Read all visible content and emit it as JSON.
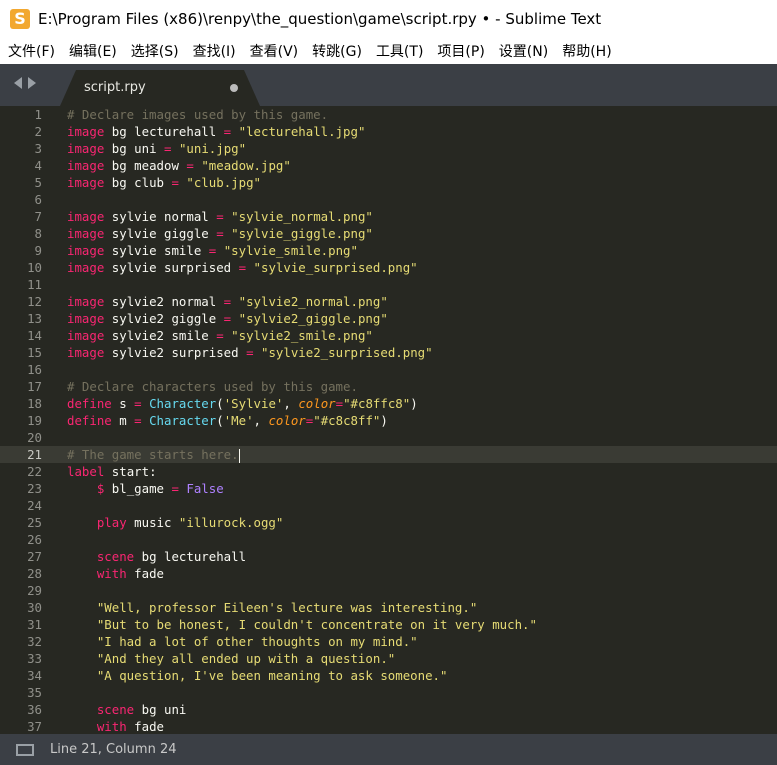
{
  "window": {
    "title": "E:\\Program Files (x86)\\renpy\\the_question\\game\\script.rpy • - Sublime Text",
    "icon": "sublime-text-icon",
    "accent": "#f2a830"
  },
  "menu": [
    {
      "label": "文件(F)"
    },
    {
      "label": "编辑(E)"
    },
    {
      "label": "选择(S)"
    },
    {
      "label": "查找(I)"
    },
    {
      "label": "查看(V)"
    },
    {
      "label": "转跳(G)"
    },
    {
      "label": "工具(T)"
    },
    {
      "label": "项目(P)"
    },
    {
      "label": "设置(N)"
    },
    {
      "label": "帮助(H)"
    }
  ],
  "tabs": [
    {
      "label": "script.rpy",
      "modified": true
    }
  ],
  "editor": {
    "active_line": 21,
    "colors": {
      "background": "#272822",
      "keyword": "#f92672",
      "string": "#e6db74",
      "comment": "#75715e",
      "function": "#66d9ef"
    },
    "lines": [
      {
        "n": "1",
        "tokens": [
          {
            "t": "# Declare images used by this game.",
            "c": "cmt"
          }
        ]
      },
      {
        "n": "2",
        "tokens": [
          {
            "t": "image",
            "c": "kw"
          },
          {
            "t": " bg lecturehall ",
            "c": "plain"
          },
          {
            "t": "=",
            "c": "kw"
          },
          {
            "t": " ",
            "c": "plain"
          },
          {
            "t": "\"lecturehall.jpg\"",
            "c": "str"
          }
        ]
      },
      {
        "n": "3",
        "tokens": [
          {
            "t": "image",
            "c": "kw"
          },
          {
            "t": " bg uni ",
            "c": "plain"
          },
          {
            "t": "=",
            "c": "kw"
          },
          {
            "t": " ",
            "c": "plain"
          },
          {
            "t": "\"uni.jpg\"",
            "c": "str"
          }
        ]
      },
      {
        "n": "4",
        "tokens": [
          {
            "t": "image",
            "c": "kw"
          },
          {
            "t": " bg meadow ",
            "c": "plain"
          },
          {
            "t": "=",
            "c": "kw"
          },
          {
            "t": " ",
            "c": "plain"
          },
          {
            "t": "\"meadow.jpg\"",
            "c": "str"
          }
        ]
      },
      {
        "n": "5",
        "tokens": [
          {
            "t": "image",
            "c": "kw"
          },
          {
            "t": " bg club ",
            "c": "plain"
          },
          {
            "t": "=",
            "c": "kw"
          },
          {
            "t": " ",
            "c": "plain"
          },
          {
            "t": "\"club.jpg\"",
            "c": "str"
          }
        ]
      },
      {
        "n": "6",
        "tokens": []
      },
      {
        "n": "7",
        "tokens": [
          {
            "t": "image",
            "c": "kw"
          },
          {
            "t": " sylvie normal ",
            "c": "plain"
          },
          {
            "t": "=",
            "c": "kw"
          },
          {
            "t": " ",
            "c": "plain"
          },
          {
            "t": "\"sylvie_normal.png\"",
            "c": "str"
          }
        ]
      },
      {
        "n": "8",
        "tokens": [
          {
            "t": "image",
            "c": "kw"
          },
          {
            "t": " sylvie giggle ",
            "c": "plain"
          },
          {
            "t": "=",
            "c": "kw"
          },
          {
            "t": " ",
            "c": "plain"
          },
          {
            "t": "\"sylvie_giggle.png\"",
            "c": "str"
          }
        ]
      },
      {
        "n": "9",
        "tokens": [
          {
            "t": "image",
            "c": "kw"
          },
          {
            "t": " sylvie smile ",
            "c": "plain"
          },
          {
            "t": "=",
            "c": "kw"
          },
          {
            "t": " ",
            "c": "plain"
          },
          {
            "t": "\"sylvie_smile.png\"",
            "c": "str"
          }
        ]
      },
      {
        "n": "10",
        "tokens": [
          {
            "t": "image",
            "c": "kw"
          },
          {
            "t": " sylvie surprised ",
            "c": "plain"
          },
          {
            "t": "=",
            "c": "kw"
          },
          {
            "t": " ",
            "c": "plain"
          },
          {
            "t": "\"sylvie_surprised.png\"",
            "c": "str"
          }
        ]
      },
      {
        "n": "11",
        "tokens": []
      },
      {
        "n": "12",
        "tokens": [
          {
            "t": "image",
            "c": "kw"
          },
          {
            "t": " sylvie2 normal ",
            "c": "plain"
          },
          {
            "t": "=",
            "c": "kw"
          },
          {
            "t": " ",
            "c": "plain"
          },
          {
            "t": "\"sylvie2_normal.png\"",
            "c": "str"
          }
        ]
      },
      {
        "n": "13",
        "tokens": [
          {
            "t": "image",
            "c": "kw"
          },
          {
            "t": " sylvie2 giggle ",
            "c": "plain"
          },
          {
            "t": "=",
            "c": "kw"
          },
          {
            "t": " ",
            "c": "plain"
          },
          {
            "t": "\"sylvie2_giggle.png\"",
            "c": "str"
          }
        ]
      },
      {
        "n": "14",
        "tokens": [
          {
            "t": "image",
            "c": "kw"
          },
          {
            "t": " sylvie2 smile ",
            "c": "plain"
          },
          {
            "t": "=",
            "c": "kw"
          },
          {
            "t": " ",
            "c": "plain"
          },
          {
            "t": "\"sylvie2_smile.png\"",
            "c": "str"
          }
        ]
      },
      {
        "n": "15",
        "tokens": [
          {
            "t": "image",
            "c": "kw"
          },
          {
            "t": " sylvie2 surprised ",
            "c": "plain"
          },
          {
            "t": "=",
            "c": "kw"
          },
          {
            "t": " ",
            "c": "plain"
          },
          {
            "t": "\"sylvie2_surprised.png\"",
            "c": "str"
          }
        ]
      },
      {
        "n": "16",
        "tokens": []
      },
      {
        "n": "17",
        "tokens": [
          {
            "t": "# Declare characters used by this game.",
            "c": "cmt"
          }
        ]
      },
      {
        "n": "18",
        "tokens": [
          {
            "t": "define",
            "c": "kw"
          },
          {
            "t": " s ",
            "c": "plain"
          },
          {
            "t": "=",
            "c": "kw"
          },
          {
            "t": " ",
            "c": "plain"
          },
          {
            "t": "Character",
            "c": "fn"
          },
          {
            "t": "(",
            "c": "plain"
          },
          {
            "t": "'Sylvie'",
            "c": "str"
          },
          {
            "t": ", ",
            "c": "plain"
          },
          {
            "t": "color",
            "c": "arg"
          },
          {
            "t": "=",
            "c": "kw"
          },
          {
            "t": "\"#c8ffc8\"",
            "c": "str"
          },
          {
            "t": ")",
            "c": "plain"
          }
        ]
      },
      {
        "n": "19",
        "tokens": [
          {
            "t": "define",
            "c": "kw"
          },
          {
            "t": " m ",
            "c": "plain"
          },
          {
            "t": "=",
            "c": "kw"
          },
          {
            "t": " ",
            "c": "plain"
          },
          {
            "t": "Character",
            "c": "fn"
          },
          {
            "t": "(",
            "c": "plain"
          },
          {
            "t": "'Me'",
            "c": "str"
          },
          {
            "t": ", ",
            "c": "plain"
          },
          {
            "t": "color",
            "c": "arg"
          },
          {
            "t": "=",
            "c": "kw"
          },
          {
            "t": "\"#c8c8ff\"",
            "c": "str"
          },
          {
            "t": ")",
            "c": "plain"
          }
        ]
      },
      {
        "n": "20",
        "tokens": []
      },
      {
        "n": "21",
        "tokens": [
          {
            "t": "# The game starts here.",
            "c": "cmt"
          }
        ]
      },
      {
        "n": "22",
        "tokens": [
          {
            "t": "label",
            "c": "kw"
          },
          {
            "t": " start:",
            "c": "plain"
          }
        ]
      },
      {
        "n": "23",
        "tokens": [
          {
            "t": "    ",
            "c": "plain"
          },
          {
            "t": "$",
            "c": "kw"
          },
          {
            "t": " bl_game ",
            "c": "plain"
          },
          {
            "t": "=",
            "c": "kw"
          },
          {
            "t": " ",
            "c": "plain"
          },
          {
            "t": "False",
            "c": "const"
          }
        ]
      },
      {
        "n": "24",
        "tokens": []
      },
      {
        "n": "25",
        "tokens": [
          {
            "t": "    ",
            "c": "plain"
          },
          {
            "t": "play",
            "c": "kw"
          },
          {
            "t": " music ",
            "c": "plain"
          },
          {
            "t": "\"illurock.ogg\"",
            "c": "str spell"
          }
        ]
      },
      {
        "n": "26",
        "tokens": []
      },
      {
        "n": "27",
        "tokens": [
          {
            "t": "    ",
            "c": "plain"
          },
          {
            "t": "scene",
            "c": "kw"
          },
          {
            "t": " bg lecturehall",
            "c": "plain"
          }
        ]
      },
      {
        "n": "28",
        "tokens": [
          {
            "t": "    ",
            "c": "plain"
          },
          {
            "t": "with",
            "c": "kw"
          },
          {
            "t": " fade",
            "c": "plain"
          }
        ]
      },
      {
        "n": "29",
        "tokens": []
      },
      {
        "n": "30",
        "tokens": [
          {
            "t": "    ",
            "c": "plain"
          },
          {
            "t": "\"Well, professor Eileen's lecture was interesting.\"",
            "c": "str"
          }
        ]
      },
      {
        "n": "31",
        "tokens": [
          {
            "t": "    ",
            "c": "plain"
          },
          {
            "t": "\"But to be honest, I couldn't concentrate on it very much.\"",
            "c": "str"
          }
        ]
      },
      {
        "n": "32",
        "tokens": [
          {
            "t": "    ",
            "c": "plain"
          },
          {
            "t": "\"I had a lot of other thoughts on my mind.\"",
            "c": "str"
          }
        ]
      },
      {
        "n": "33",
        "tokens": [
          {
            "t": "    ",
            "c": "plain"
          },
          {
            "t": "\"And they all ended up with a question.\"",
            "c": "str"
          }
        ]
      },
      {
        "n": "34",
        "tokens": [
          {
            "t": "    ",
            "c": "plain"
          },
          {
            "t": "\"A question, I've been meaning to ask someone.\"",
            "c": "str"
          }
        ]
      },
      {
        "n": "35",
        "tokens": []
      },
      {
        "n": "36",
        "tokens": [
          {
            "t": "    ",
            "c": "plain"
          },
          {
            "t": "scene",
            "c": "kw"
          },
          {
            "t": " bg uni",
            "c": "plain"
          }
        ]
      },
      {
        "n": "37",
        "tokens": [
          {
            "t": "    ",
            "c": "plain"
          },
          {
            "t": "with",
            "c": "kw"
          },
          {
            "t": " fade",
            "c": "plain"
          }
        ]
      }
    ]
  },
  "status": {
    "position": "Line 21, Column 24",
    "icon": "panel-toggle-icon"
  }
}
